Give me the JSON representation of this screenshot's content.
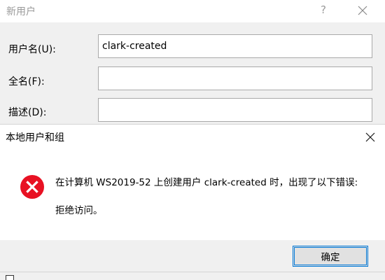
{
  "new_user_dialog": {
    "title": "新用户",
    "help_glyph": "?",
    "fields": {
      "username_label": "用户名(U):",
      "username_value": "clark-created",
      "fullname_label": "全名(F):",
      "fullname_value": "",
      "description_label": "描述(D):",
      "description_value": ""
    }
  },
  "error_dialog": {
    "title": "本地用户和组",
    "message": "在计算机 WS2019-52 上创建用户 clark-created 时，出现了以下错误:",
    "detail": "拒绝访问。",
    "ok_label": "确定"
  },
  "colors": {
    "error_red": "#e81123",
    "focus_blue": "#0078d7"
  },
  "icons": {
    "back_close": "close-icon",
    "error_close": "close-icon",
    "error": "error-icon"
  }
}
